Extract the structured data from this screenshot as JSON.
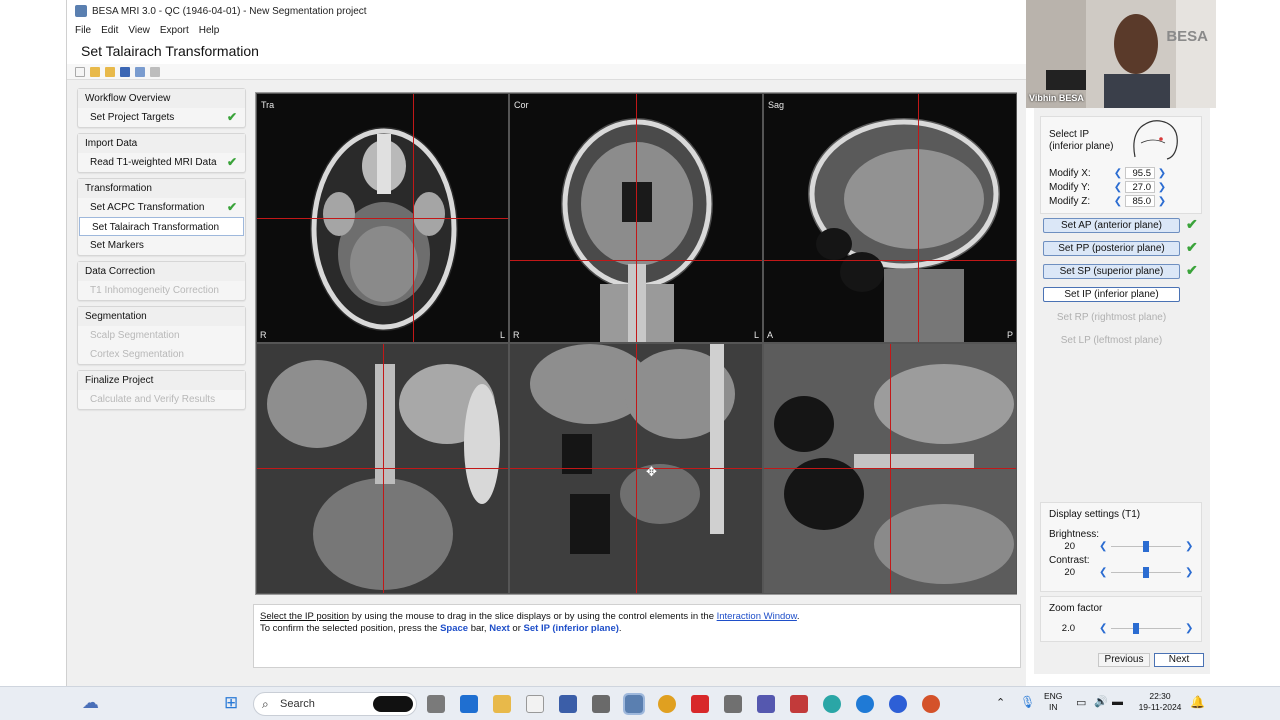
{
  "window": {
    "title": "BESA MRI 3.0 - QC (1946-04-01) - New Segmentation project"
  },
  "menu": [
    "File",
    "Edit",
    "View",
    "Export",
    "Help"
  ],
  "page_title": "Set Talairach Transformation",
  "workflow": [
    {
      "head": "Workflow Overview",
      "items": [
        {
          "label": "Set Project Targets",
          "done": true,
          "state": "normal"
        }
      ]
    },
    {
      "head": "Import Data",
      "items": [
        {
          "label": "Read T1-weighted MRI Data",
          "done": true,
          "state": "normal"
        }
      ]
    },
    {
      "head": "Transformation",
      "items": [
        {
          "label": "Set ACPC Transformation",
          "done": true,
          "state": "normal"
        },
        {
          "label": "Set Talairach Transformation",
          "done": false,
          "state": "active"
        },
        {
          "label": "Set Markers",
          "done": false,
          "state": "normal"
        }
      ]
    },
    {
      "head": "Data Correction",
      "items": [
        {
          "label": "T1 Inhomogeneity Correction",
          "done": false,
          "state": "disabled"
        }
      ]
    },
    {
      "head": "Segmentation",
      "items": [
        {
          "label": "Scalp Segmentation",
          "done": false,
          "state": "disabled"
        },
        {
          "label": "Cortex Segmentation",
          "done": false,
          "state": "disabled"
        }
      ]
    },
    {
      "head": "Finalize Project",
      "items": [
        {
          "label": "Calculate and Verify Results",
          "done": false,
          "state": "disabled"
        }
      ]
    }
  ],
  "views": {
    "tra": {
      "label": "Tra",
      "left": "R",
      "right": "L"
    },
    "cor": {
      "label": "Cor",
      "left": "R",
      "right": "L"
    },
    "sag": {
      "label": "Sag",
      "left": "A",
      "right": "P"
    }
  },
  "info": {
    "line1_link1": "Select the IP position",
    "line1_mid": " by using the mouse to drag in the slice displays or by using the control elements in the ",
    "line1_link2": "Interaction Window",
    "line1_end": ".",
    "line2_start": "To confirm the selected position, press the ",
    "line2_space": "Space",
    "line2_bar": " bar, ",
    "line2_next": "Next",
    "line2_or": " or ",
    "line2_setip": "Set IP (inferior plane)",
    "line2_end": "."
  },
  "controls": {
    "select_ip_line1": "Select IP",
    "select_ip_line2": "(inferior plane)",
    "modify_x_label": "Modify X:",
    "modify_x": "95.5",
    "modify_y_label": "Modify Y:",
    "modify_y": "27.0",
    "modify_z_label": "Modify Z:",
    "modify_z": "85.0"
  },
  "plane_buttons": [
    {
      "label": "Set AP (anterior plane)",
      "done": true,
      "state": "done"
    },
    {
      "label": "Set PP (posterior plane)",
      "done": true,
      "state": "done"
    },
    {
      "label": "Set SP (superior plane)",
      "done": true,
      "state": "done"
    },
    {
      "label": "Set IP (inferior plane)",
      "done": false,
      "state": "current"
    },
    {
      "label": "Set RP (rightmost plane)",
      "done": false,
      "state": "disabled"
    },
    {
      "label": "Set LP (leftmost plane)",
      "done": false,
      "state": "disabled"
    }
  ],
  "display": {
    "title": "Display settings (T1)",
    "brightness_label": "Brightness:",
    "brightness": "20",
    "brightness_level": 0.5,
    "contrast_label": "Contrast:",
    "contrast": "20",
    "contrast_level": 0.5,
    "zoom_label": "Zoom factor",
    "zoom": "2.0",
    "zoom_level": 0.35
  },
  "nav": {
    "previous": "Previous",
    "next": "Next"
  },
  "webcam": {
    "name": "Vibhin BESA",
    "sign": "BESA"
  },
  "taskbar": {
    "search": "Search",
    "lang1": "ENG",
    "lang2": "IN",
    "time": "22:30",
    "date": "19-11-2024"
  },
  "colors": {
    "accent": "#2b6cd1",
    "check": "#3aa33a",
    "crosshair": "#c21818"
  }
}
